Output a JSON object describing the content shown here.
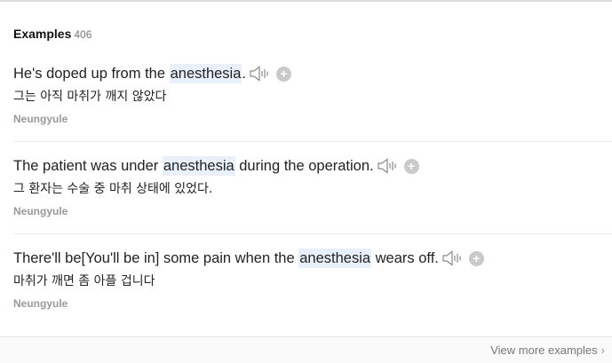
{
  "section": {
    "title": "Examples",
    "count": "406"
  },
  "examples": [
    {
      "en_before": "He's doped up from the ",
      "highlight": "anesthesia",
      "en_after": ".",
      "ko": "그는 아직 마취가 깨지 않았다",
      "source": "Neungyule"
    },
    {
      "en_before": "The patient was under ",
      "highlight": "anesthesia",
      "en_after": " during the operation.",
      "ko": "그 환자는 수술 중 마취 상태에 있었다.",
      "source": "Neungyule"
    },
    {
      "en_before": "There'll be[You'll be in] some pain when the ",
      "highlight": "anesthesia",
      "en_after": " wears off.",
      "ko": "마취가 깨면 좀 아플 겁니다",
      "source": "Neungyule"
    }
  ],
  "add_symbol": "+",
  "footer": {
    "view_more": "View more examples",
    "chevron": "›"
  },
  "icons": {
    "speaker": "speaker-icon",
    "add": "plus-circle-icon"
  },
  "colors": {
    "highlight": "#e8f1fb",
    "source_text": "#999999",
    "add_button": "#c9c9c9"
  }
}
